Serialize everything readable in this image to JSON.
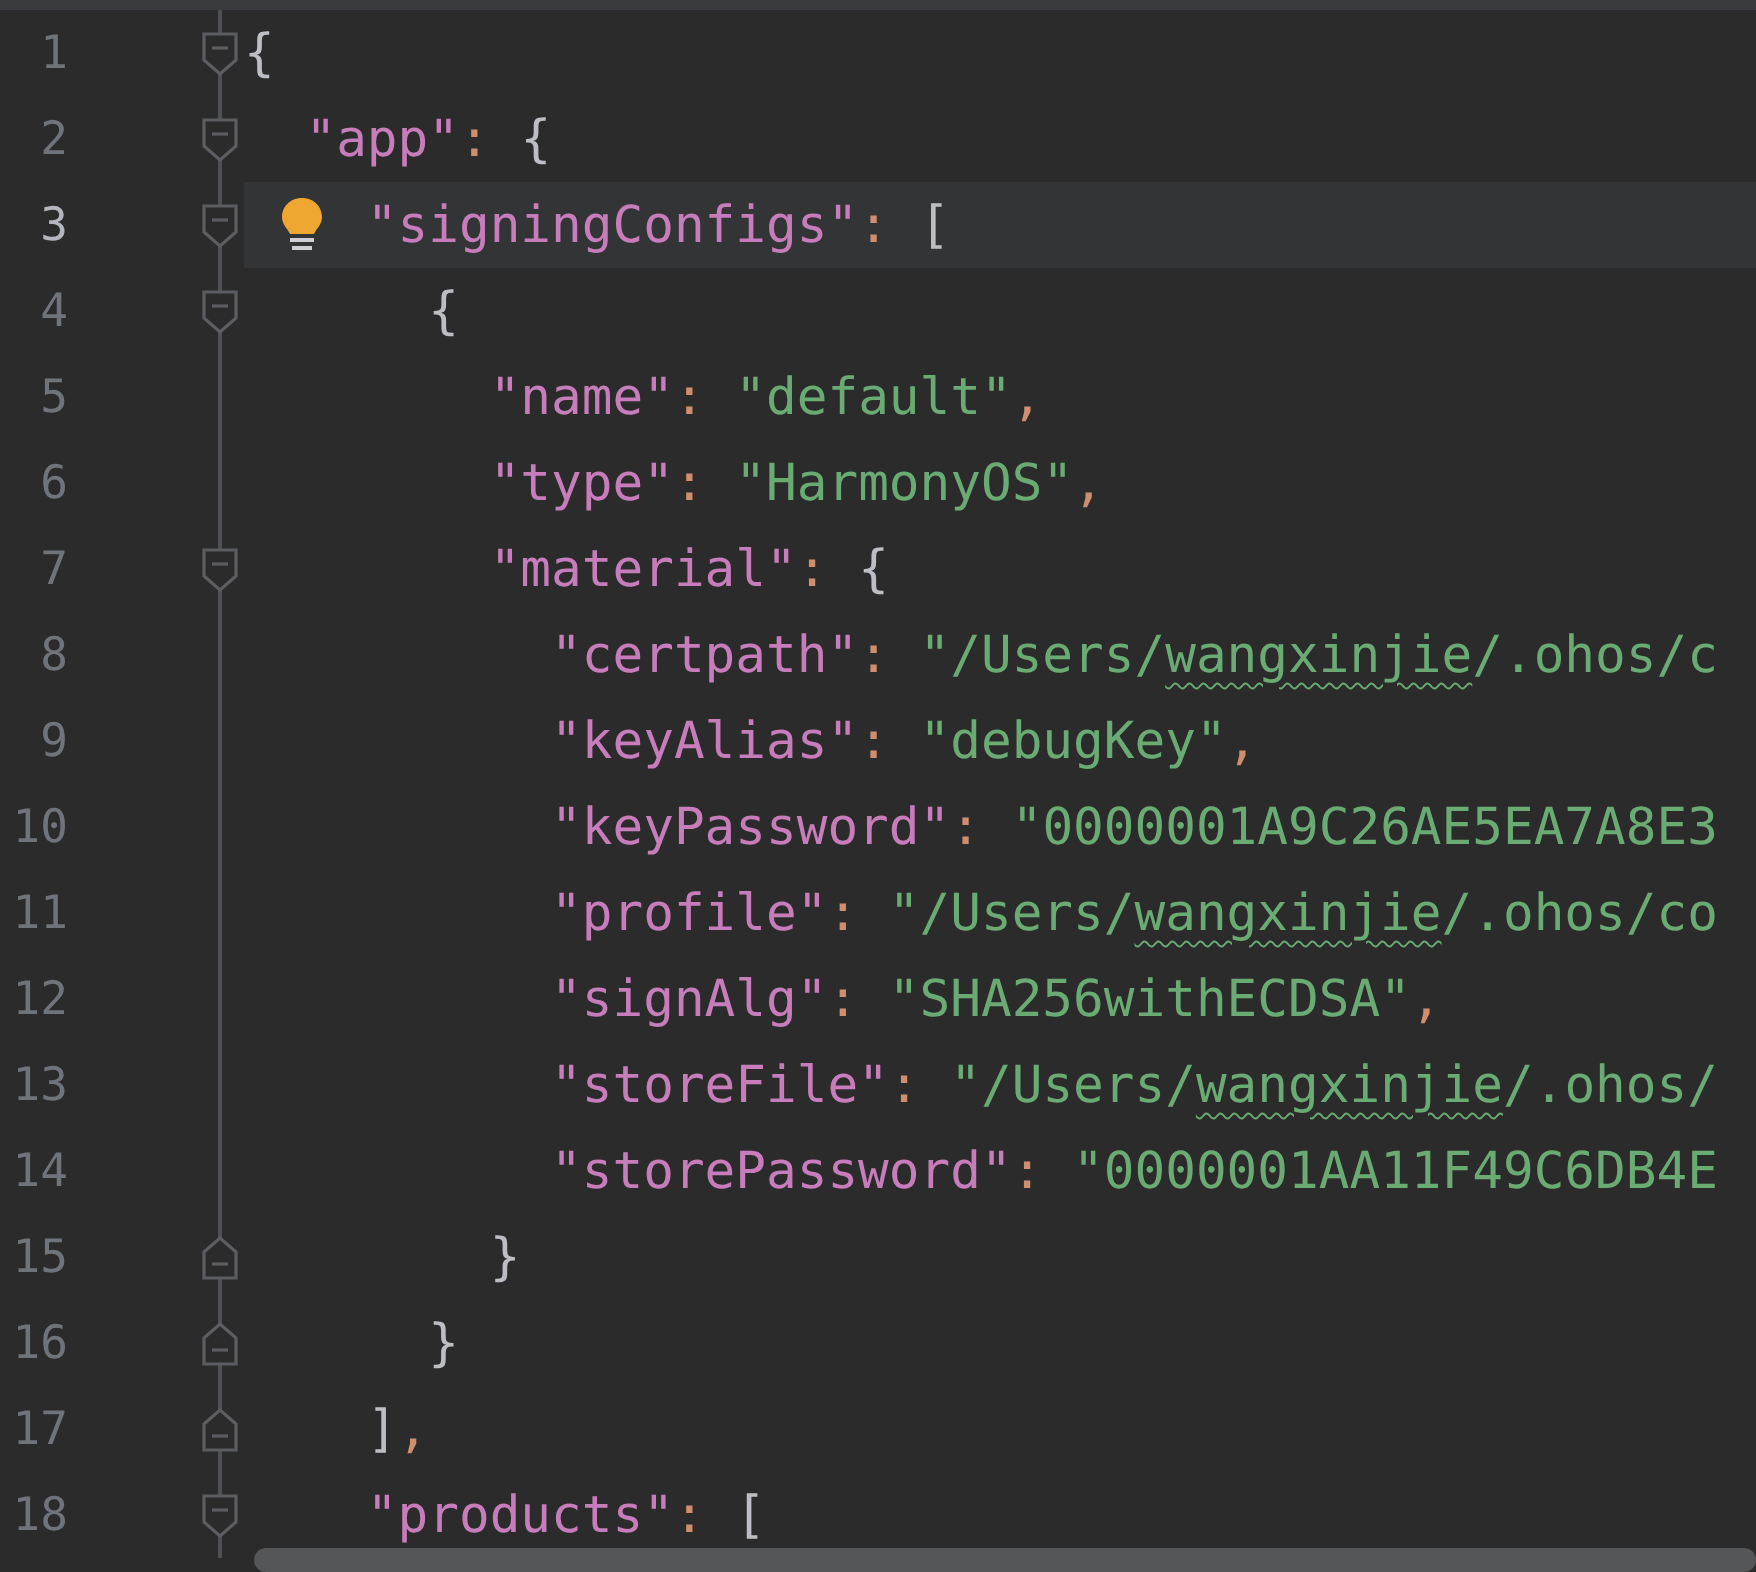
{
  "editor": {
    "lines": [
      {
        "number": "1",
        "kind": "fold-open",
        "current": false,
        "bulb": false,
        "tokens": [
          {
            "kind": "brace",
            "text": "{"
          }
        ]
      },
      {
        "number": "2",
        "kind": "fold-open",
        "current": false,
        "bulb": false,
        "tokens": [
          {
            "kind": "key",
            "text": "  \"app\""
          },
          {
            "kind": "punct",
            "text": ":"
          },
          {
            "kind": "brace",
            "text": " {"
          }
        ]
      },
      {
        "number": "3",
        "kind": "fold-open",
        "current": true,
        "bulb": true,
        "tokens": [
          {
            "kind": "key",
            "text": "    \"signingConfigs\""
          },
          {
            "kind": "punct",
            "text": ":"
          },
          {
            "kind": "brace",
            "text": " ["
          }
        ]
      },
      {
        "number": "4",
        "kind": "fold-open",
        "current": false,
        "bulb": false,
        "tokens": [
          {
            "kind": "brace",
            "text": "      {"
          }
        ]
      },
      {
        "number": "5",
        "kind": "plain",
        "current": false,
        "bulb": false,
        "tokens": [
          {
            "kind": "key",
            "text": "        \"name\""
          },
          {
            "kind": "punct",
            "text": ":"
          },
          {
            "kind": "string",
            "text": " \"default\""
          },
          {
            "kind": "punct",
            "text": ","
          }
        ]
      },
      {
        "number": "6",
        "kind": "plain",
        "current": false,
        "bulb": false,
        "tokens": [
          {
            "kind": "key",
            "text": "        \"type\""
          },
          {
            "kind": "punct",
            "text": ":"
          },
          {
            "kind": "string",
            "text": " \"HarmonyOS\""
          },
          {
            "kind": "punct",
            "text": ","
          }
        ]
      },
      {
        "number": "7",
        "kind": "fold-open",
        "current": false,
        "bulb": false,
        "tokens": [
          {
            "kind": "key",
            "text": "        \"material\""
          },
          {
            "kind": "punct",
            "text": ":"
          },
          {
            "kind": "brace",
            "text": " {"
          }
        ]
      },
      {
        "number": "8",
        "kind": "plain",
        "current": false,
        "bulb": false,
        "tokens": [
          {
            "kind": "key",
            "text": "          \"certpath\""
          },
          {
            "kind": "punct",
            "text": ":"
          },
          {
            "kind": "string",
            "text": " \"/Users/"
          },
          {
            "kind": "typo",
            "text": "wangxinjie"
          },
          {
            "kind": "string",
            "text": "/.ohos/c"
          }
        ]
      },
      {
        "number": "9",
        "kind": "plain",
        "current": false,
        "bulb": false,
        "tokens": [
          {
            "kind": "key",
            "text": "          \"keyAlias\""
          },
          {
            "kind": "punct",
            "text": ":"
          },
          {
            "kind": "string",
            "text": " \"debugKey\""
          },
          {
            "kind": "punct",
            "text": ","
          }
        ]
      },
      {
        "number": "10",
        "kind": "plain",
        "current": false,
        "bulb": false,
        "tokens": [
          {
            "kind": "key",
            "text": "          \"keyPassword\""
          },
          {
            "kind": "punct",
            "text": ":"
          },
          {
            "kind": "string",
            "text": " \"0000001A9C26AE5EA7A8E3"
          }
        ]
      },
      {
        "number": "11",
        "kind": "plain",
        "current": false,
        "bulb": false,
        "tokens": [
          {
            "kind": "key",
            "text": "          \"profile\""
          },
          {
            "kind": "punct",
            "text": ":"
          },
          {
            "kind": "string",
            "text": " \"/Users/"
          },
          {
            "kind": "typo",
            "text": "wangxinjie"
          },
          {
            "kind": "string",
            "text": "/.ohos/co"
          }
        ]
      },
      {
        "number": "12",
        "kind": "plain",
        "current": false,
        "bulb": false,
        "tokens": [
          {
            "kind": "key",
            "text": "          \"signAlg\""
          },
          {
            "kind": "punct",
            "text": ":"
          },
          {
            "kind": "string",
            "text": " \"SHA256withECDSA\""
          },
          {
            "kind": "punct",
            "text": ","
          }
        ]
      },
      {
        "number": "13",
        "kind": "plain",
        "current": false,
        "bulb": false,
        "tokens": [
          {
            "kind": "key",
            "text": "          \"storeFile\""
          },
          {
            "kind": "punct",
            "text": ":"
          },
          {
            "kind": "string",
            "text": " \"/Users/"
          },
          {
            "kind": "typo",
            "text": "wangxinjie"
          },
          {
            "kind": "string",
            "text": "/.ohos/"
          }
        ]
      },
      {
        "number": "14",
        "kind": "plain",
        "current": false,
        "bulb": false,
        "tokens": [
          {
            "kind": "key",
            "text": "          \"storePassword\""
          },
          {
            "kind": "punct",
            "text": ":"
          },
          {
            "kind": "string",
            "text": " \"0000001AA11F49C6DB4E"
          }
        ]
      },
      {
        "number": "15",
        "kind": "fold-close",
        "current": false,
        "bulb": false,
        "tokens": [
          {
            "kind": "brace",
            "text": "        }"
          }
        ]
      },
      {
        "number": "16",
        "kind": "fold-close",
        "current": false,
        "bulb": false,
        "tokens": [
          {
            "kind": "brace",
            "text": "      }"
          }
        ]
      },
      {
        "number": "17",
        "kind": "fold-close",
        "current": false,
        "bulb": false,
        "tokens": [
          {
            "kind": "brace",
            "text": "    ]"
          },
          {
            "kind": "punct",
            "text": ","
          }
        ]
      },
      {
        "number": "18",
        "kind": "fold-open",
        "current": false,
        "bulb": false,
        "tokens": [
          {
            "kind": "key",
            "text": "    \"products\""
          },
          {
            "kind": "punct",
            "text": ":"
          },
          {
            "kind": "brace",
            "text": " ["
          }
        ]
      }
    ]
  }
}
